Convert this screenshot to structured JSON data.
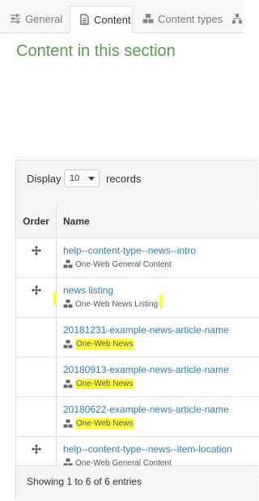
{
  "tabs": [
    {
      "label": "General",
      "icon": "sliders-icon",
      "active": false
    },
    {
      "label": "Content",
      "icon": "document-icon",
      "active": true
    },
    {
      "label": "Content types",
      "icon": "cubes-icon",
      "active": false
    }
  ],
  "section_title": "Content in this section",
  "display": {
    "label_before": "Display",
    "selected": "10",
    "label_after": "records"
  },
  "table": {
    "columns": [
      "Order",
      "Name"
    ],
    "rows": [
      {
        "movable": true,
        "title": "help--content-type--news--intro",
        "type": "One-Web General Content",
        "highlighted": false
      },
      {
        "movable": true,
        "title": "news listing",
        "type": "One-Web News Listing",
        "highlighted": false
      },
      {
        "movable": false,
        "title": "20181231-example-news-article-name",
        "type": "One-Web News",
        "highlighted": true
      },
      {
        "movable": false,
        "title": "20180913-example-news-article-name",
        "type": "One-Web News",
        "highlighted": true
      },
      {
        "movable": false,
        "title": "20180622-example-news-article-name",
        "type": "One-Web News",
        "highlighted": true
      },
      {
        "movable": true,
        "title": "help--content-type--news--item-location",
        "type": "One-Web General Content",
        "highlighted": false
      }
    ]
  },
  "footer": "Showing 1 to 6 of 6 entries",
  "colors": {
    "title_green": "#5a9b4f",
    "link_blue": "#2f7fb8",
    "highlight": "#ffff33"
  }
}
